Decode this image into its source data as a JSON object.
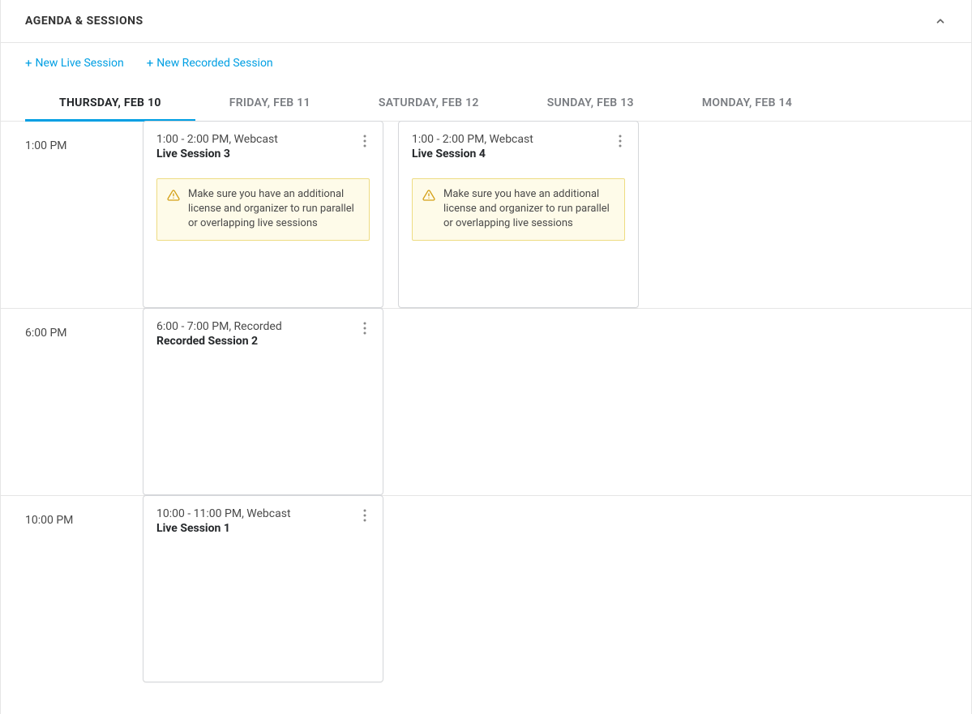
{
  "panel": {
    "title": "AGENDA & SESSIONS"
  },
  "actions": {
    "new_live": "New Live Session",
    "new_recorded": "New Recorded Session"
  },
  "tabs": [
    {
      "label": "THURSDAY, FEB 10",
      "active": true
    },
    {
      "label": "FRIDAY, FEB 11",
      "active": false
    },
    {
      "label": "SATURDAY, FEB 12",
      "active": false
    },
    {
      "label": "SUNDAY, FEB 13",
      "active": false
    },
    {
      "label": "MONDAY, FEB 14",
      "active": false
    }
  ],
  "warning_message": "Make sure you have an additional license and organizer to run parallel or overlapping live sessions",
  "timeslots": [
    {
      "time": "1:00 PM",
      "sessions": [
        {
          "meta": "1:00 - 2:00 PM, Webcast",
          "title": "Live Session 3",
          "warning": true
        },
        {
          "meta": "1:00 - 2:00 PM, Webcast",
          "title": "Live Session 4",
          "warning": true
        }
      ]
    },
    {
      "time": "6:00 PM",
      "sessions": [
        {
          "meta": "6:00 - 7:00 PM, Recorded",
          "title": "Recorded Session 2",
          "warning": false
        }
      ]
    },
    {
      "time": "10:00 PM",
      "sessions": [
        {
          "meta": "10:00 - 11:00 PM, Webcast",
          "title": "Live Session 1",
          "warning": false
        }
      ]
    }
  ]
}
